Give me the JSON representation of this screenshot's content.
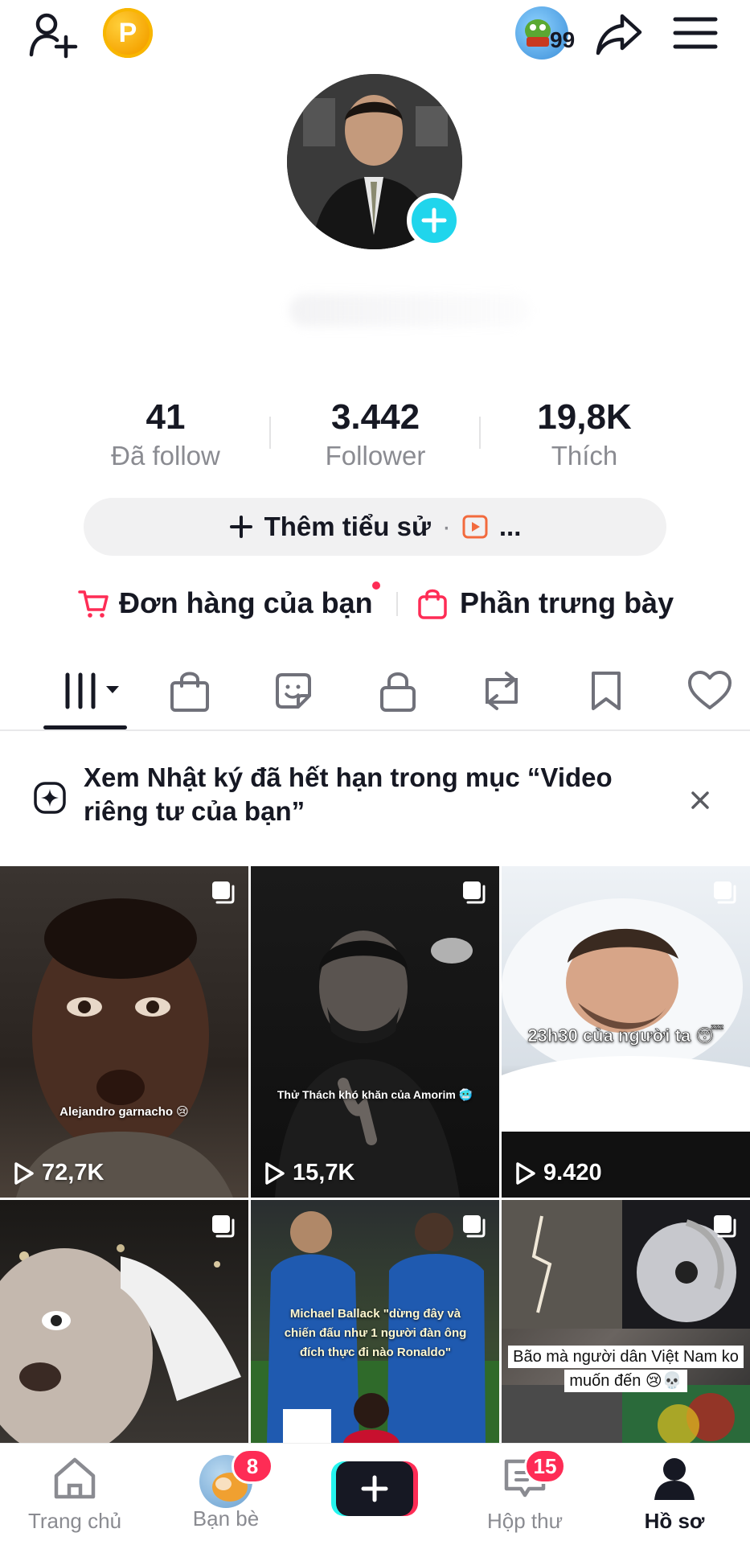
{
  "topbar": {
    "coin_letter": "P",
    "friend_activity_count": "99"
  },
  "profile": {
    "stats": [
      {
        "value": "41",
        "label": "Đã follow"
      },
      {
        "value": "3.442",
        "label": "Follower"
      },
      {
        "value": "19,8K",
        "label": "Thích"
      }
    ],
    "bio_button": {
      "label": "Thêm tiểu sử",
      "separator": "·",
      "more": "..."
    },
    "orders_label": "Đơn hàng của bạn",
    "showcase_label": "Phần trưng bày"
  },
  "banner": {
    "text": "Xem Nhật ký đã hết hạn trong mục “Video riêng tư của bạn”"
  },
  "videos": [
    {
      "views": "72,7K",
      "caption": "Alejandro garnacho 😢"
    },
    {
      "views": "15,7K",
      "caption": "Thử Thách khó khăn của Amorim 🥶"
    },
    {
      "views": "9.420",
      "caption": "23h30 của người ta 😴"
    },
    {
      "views": "",
      "caption": ""
    },
    {
      "views": "",
      "caption": "Michael Ballack \"dừng đây và chiến đấu như 1 người đàn ông đích thực đi nào Ronaldo\""
    },
    {
      "views": "",
      "caption": "Bão mà người dân Việt Nam ko muốn đến 😢💀"
    }
  ],
  "bottom_nav": [
    {
      "label": "Trang chủ"
    },
    {
      "label": "Bạn bè",
      "badge": "8"
    },
    {
      "label": ""
    },
    {
      "label": "Hộp thư",
      "badge": "15"
    },
    {
      "label": "Hồ sơ"
    }
  ],
  "colors": {
    "accent_cyan": "#20d5ec",
    "badge_red": "#fe2c55",
    "text_primary": "#161823",
    "text_secondary": "#8a8b91",
    "coin_gold": "#f5a300"
  }
}
